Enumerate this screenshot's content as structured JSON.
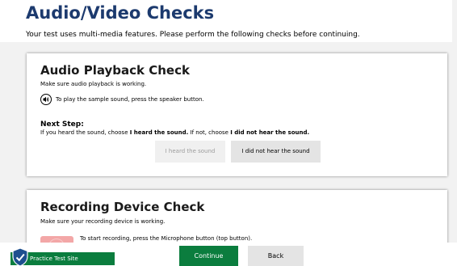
{
  "header": {
    "title": "Audio/Video Checks",
    "subtitle": "Your test uses multi-media features. Please perform the following checks before continuing."
  },
  "audio_check": {
    "title": "Audio Playback Check",
    "description": "Make sure audio playback is working.",
    "play_instruction": "To play the sample sound, press the speaker button.",
    "speaker_icon": "speaker-icon",
    "next_step_label": "Next Step:",
    "next_step_text": {
      "prefix": "If you heard the sound, choose ",
      "heard": "I heard the sound.",
      "middle": " If not, choose ",
      "not_heard": "I did not hear the sound."
    },
    "heard_button_label": "I heard the sound",
    "not_heard_button_label": "I did not hear the sound"
  },
  "recording_check": {
    "title": "Recording Device Check",
    "description": "Make sure your recording device is working.",
    "instruction": "To start recording, press the Microphone button (top button)."
  },
  "footer": {
    "practice_label": "Practice Test Site",
    "continue_label": "Continue",
    "back_label": "Back"
  },
  "colors": {
    "title_blue": "#1c3a6e",
    "brand_green": "#0b7d3e",
    "disabled_text": "#9c9c9c",
    "button_gray": "#e4e4e4",
    "mic_red": "#f3a7a7"
  }
}
